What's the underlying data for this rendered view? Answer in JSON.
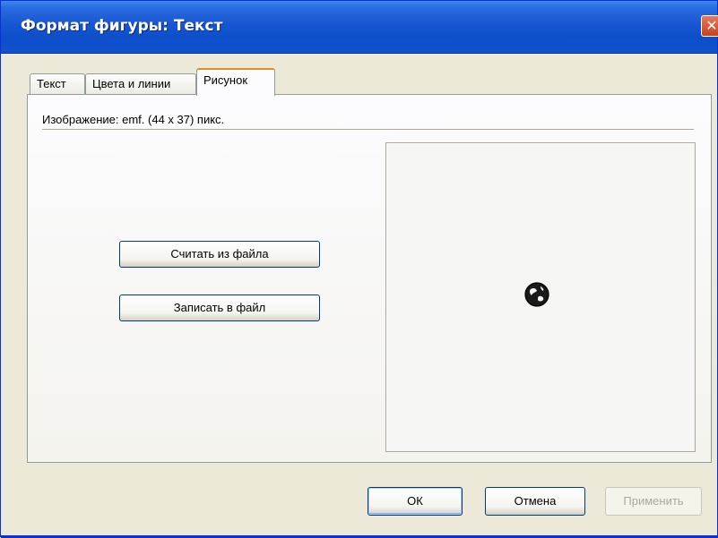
{
  "window": {
    "title": "Формат фигуры: Текст",
    "close_glyph": "✕"
  },
  "tabs": [
    {
      "label": "Текст",
      "active": false
    },
    {
      "label": "Цвета и линии",
      "active": false
    },
    {
      "label": "Рисунок",
      "active": true
    }
  ],
  "picture": {
    "info": "Изображение: emf. (44 x 37) пикс.",
    "read_button": "Считать из файла",
    "write_button": "Записать в файл",
    "preview_icon": "globe-icon"
  },
  "buttons": {
    "ok": "ОК",
    "cancel": "Отмена",
    "apply": "Применить"
  },
  "colors": {
    "title_bar": "#0d4ec9",
    "tab_highlight": "#e68b2c",
    "button_border": "#003c74"
  }
}
